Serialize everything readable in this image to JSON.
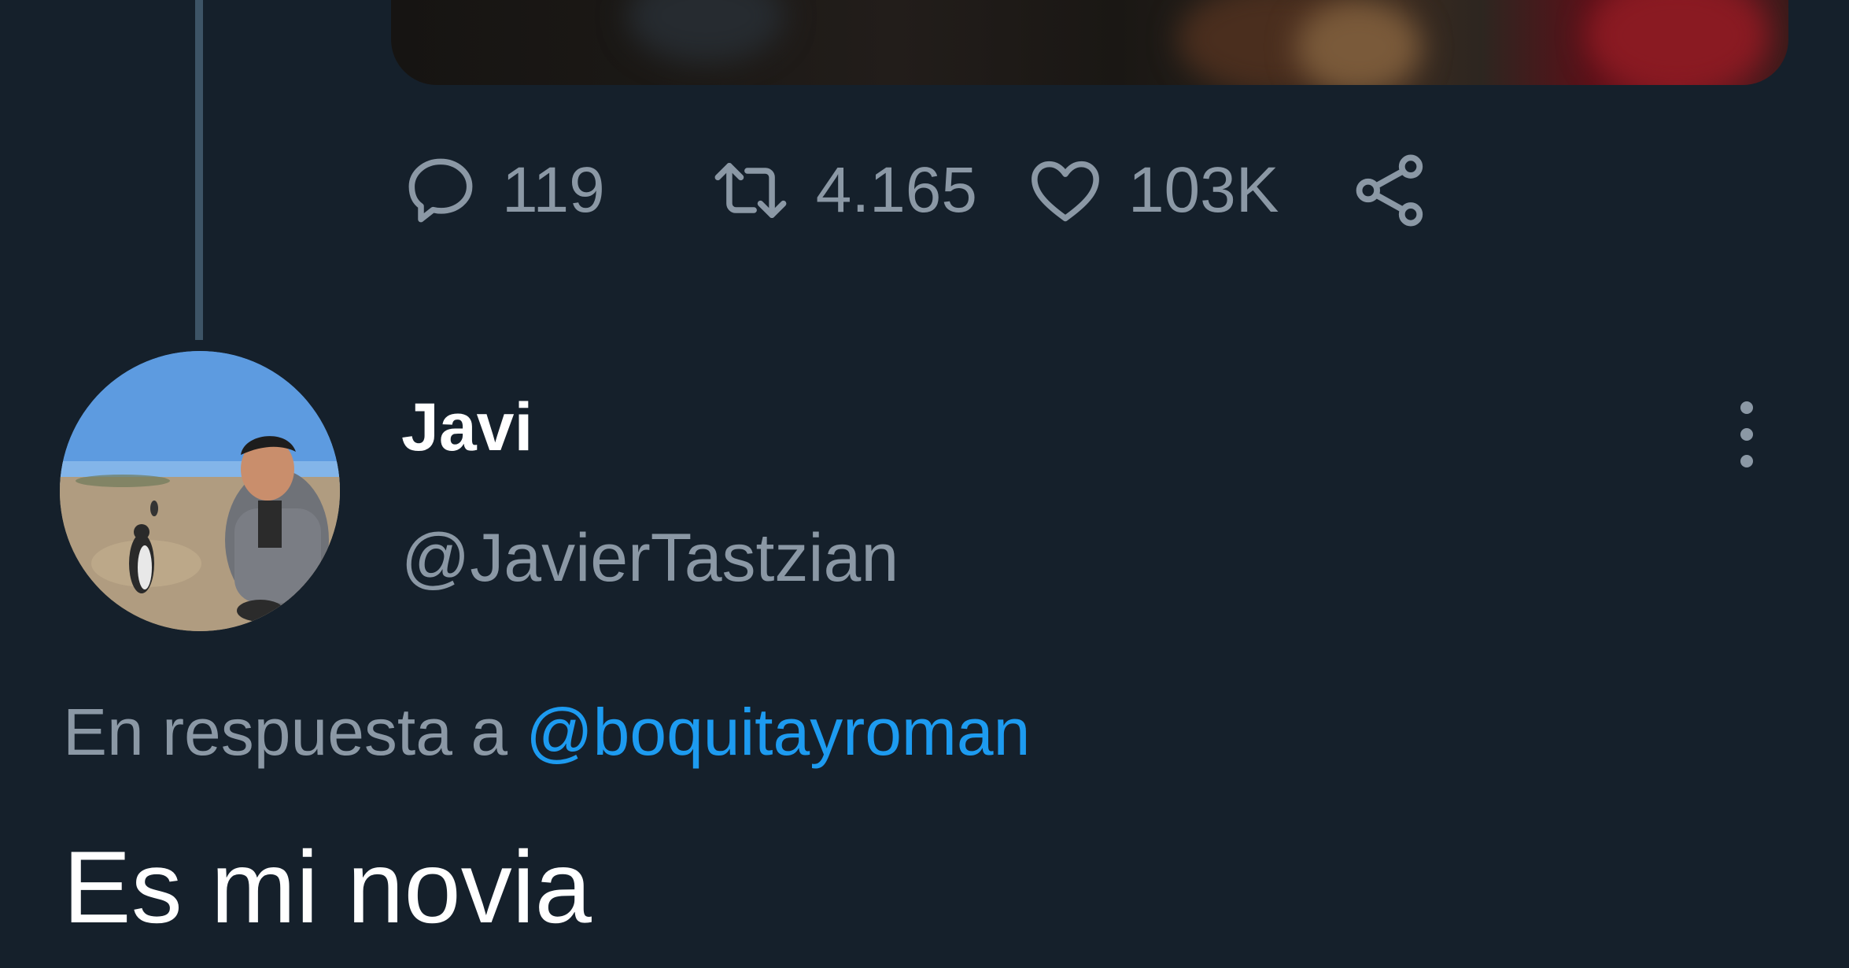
{
  "tweet_above": {
    "actions": {
      "replies": "119",
      "retweets": "4.165",
      "likes": "103K"
    },
    "icons": [
      "reply-icon",
      "retweet-icon",
      "like-icon",
      "share-icon"
    ]
  },
  "reply": {
    "author_name": "Javi",
    "author_handle": "@JavierTastzian",
    "in_reply_prefix": "En respuesta a",
    "in_reply_to": "@boquitayroman",
    "text": "Es mi novia",
    "menu_icon": "more-vertical-icon"
  },
  "colors": {
    "background": "#15202b",
    "secondary_text": "#8b98a5",
    "accent": "#1d9bf0",
    "thread_line": "#3d5466"
  }
}
